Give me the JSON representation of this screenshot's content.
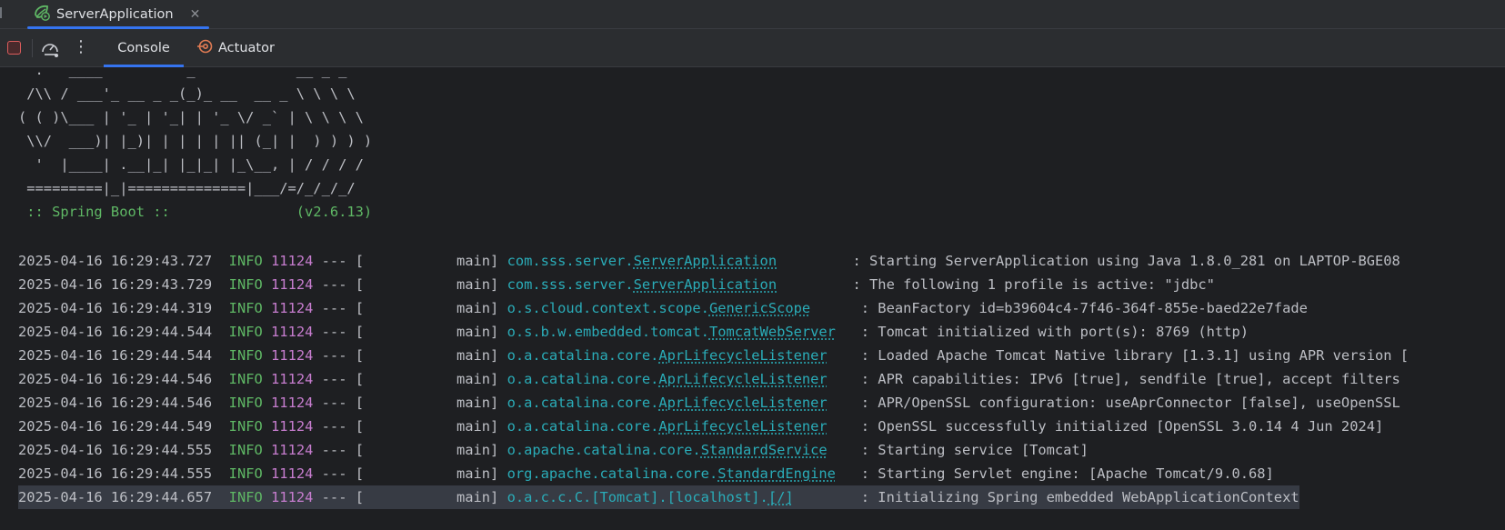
{
  "run_tab": {
    "label": "ServerApplication",
    "icon": "spring-run-icon",
    "close": "✕"
  },
  "toolbar": {
    "stop_icon": "stop-icon",
    "gauge_icon": "gauge-icon",
    "more": "⋮",
    "tabs": [
      {
        "label": "Console",
        "active": true
      },
      {
        "label": "Actuator",
        "active": false
      }
    ]
  },
  "banner": [
    "  .   ____          _            __ _ _",
    " /\\\\ / ___'_ __ _ _(_)_ __  __ _ \\ \\ \\ \\",
    "( ( )\\___ | '_ | '_| | '_ \\/ _` | \\ \\ \\ \\",
    " \\\\/  ___)| |_)| | | | | || (_| |  ) ) ) )",
    "  '  |____| .__|_| |_|_| |_\\__, | / / / /",
    " =========|_|==============|___/=/_/_/_/",
    " :: Spring Boot ::               (v2.6.13)"
  ],
  "logs": [
    {
      "ts": "2025-04-16 16:29:43.727",
      "level": "INFO",
      "pid": "11124",
      "sep": "---",
      "thread": "[           main]",
      "pkg": "com.sss.server.",
      "cls": "ServerApplication",
      "pad": "        ",
      "msg": ": Starting ServerApplication using Java 1.8.0_281 on LAPTOP-BGE08"
    },
    {
      "ts": "2025-04-16 16:29:43.729",
      "level": "INFO",
      "pid": "11124",
      "sep": "---",
      "thread": "[           main]",
      "pkg": "com.sss.server.",
      "cls": "ServerApplication",
      "pad": "        ",
      "msg": ": The following 1 profile is active: \"jdbc\""
    },
    {
      "ts": "2025-04-16 16:29:44.319",
      "level": "INFO",
      "pid": "11124",
      "sep": "---",
      "thread": "[           main]",
      "pkg": "o.s.cloud.context.scope.",
      "cls": "GenericScope",
      "pad": "     ",
      "msg": ": BeanFactory id=b39604c4-7f46-364f-855e-baed22e7fade"
    },
    {
      "ts": "2025-04-16 16:29:44.544",
      "level": "INFO",
      "pid": "11124",
      "sep": "---",
      "thread": "[           main]",
      "pkg": "o.s.b.w.embedded.tomcat.",
      "cls": "TomcatWebServer",
      "pad": "  ",
      "msg": ": Tomcat initialized with port(s): 8769 (http)"
    },
    {
      "ts": "2025-04-16 16:29:44.544",
      "level": "INFO",
      "pid": "11124",
      "sep": "---",
      "thread": "[           main]",
      "pkg": "o.a.catalina.core.",
      "cls": "AprLifecycleListener",
      "pad": "   ",
      "msg": ": Loaded Apache Tomcat Native library [1.3.1] using APR version ["
    },
    {
      "ts": "2025-04-16 16:29:44.546",
      "level": "INFO",
      "pid": "11124",
      "sep": "---",
      "thread": "[           main]",
      "pkg": "o.a.catalina.core.",
      "cls": "AprLifecycleListener",
      "pad": "   ",
      "msg": ": APR capabilities: IPv6 [true], sendfile [true], accept filters"
    },
    {
      "ts": "2025-04-16 16:29:44.546",
      "level": "INFO",
      "pid": "11124",
      "sep": "---",
      "thread": "[           main]",
      "pkg": "o.a.catalina.core.",
      "cls": "AprLifecycleListener",
      "pad": "   ",
      "msg": ": APR/OpenSSL configuration: useAprConnector [false], useOpenSSL"
    },
    {
      "ts": "2025-04-16 16:29:44.549",
      "level": "INFO",
      "pid": "11124",
      "sep": "---",
      "thread": "[           main]",
      "pkg": "o.a.catalina.core.",
      "cls": "AprLifecycleListener",
      "pad": "   ",
      "msg": ": OpenSSL successfully initialized [OpenSSL 3.0.14 4 Jun 2024]"
    },
    {
      "ts": "2025-04-16 16:29:44.555",
      "level": "INFO",
      "pid": "11124",
      "sep": "---",
      "thread": "[           main]",
      "pkg": "o.apache.catalina.core.",
      "cls": "StandardService",
      "pad": "   ",
      "msg": ": Starting service [Tomcat]"
    },
    {
      "ts": "2025-04-16 16:29:44.555",
      "level": "INFO",
      "pid": "11124",
      "sep": "---",
      "thread": "[           main]",
      "pkg": "org.apache.catalina.core.",
      "cls": "StandardEngine",
      "pad": "  ",
      "msg": ": Starting Servlet engine: [Apache Tomcat/9.0.68]"
    },
    {
      "ts": "2025-04-16 16:29:44.657",
      "level": "INFO",
      "pid": "11124",
      "sep": "---",
      "thread": "[           main]",
      "pkg": "o.a.c.c.C.[Tomcat].[localhost].",
      "cls": "[/]",
      "pad": "       ",
      "msg": ": Initializing Spring embedded WebApplicationContext"
    }
  ],
  "colors": {
    "background": "#1e1f22",
    "panel": "#2b2d30",
    "accent": "#3574f0",
    "info": "#5fb865",
    "pid": "#c77dcf",
    "logger": "#2aacb8",
    "stop": "#db5c5c"
  }
}
